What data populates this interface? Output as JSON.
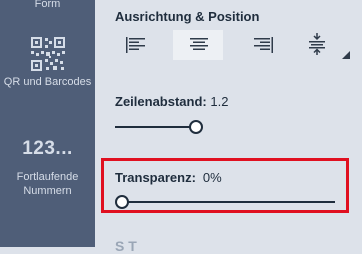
{
  "sidebar": {
    "items": [
      {
        "label": "Form"
      },
      {
        "label": "QR und Barcodes"
      },
      {
        "glyph": "123...",
        "label": "Fortlaufende Nummern"
      }
    ]
  },
  "panel": {
    "alignment": {
      "heading": "Ausrichtung & Position",
      "buttons": [
        {
          "icon": "align-left-icon"
        },
        {
          "icon": "align-center-icon",
          "active": true
        },
        {
          "icon": "align-right-icon"
        },
        {
          "icon": "vertical-align-icon"
        }
      ]
    },
    "line_spacing": {
      "label": "Zeilenabstand:",
      "value": "1.2"
    },
    "transparency": {
      "label": "Transparenz:",
      "value": "0%"
    },
    "cut_off_heading": "S     T"
  },
  "colors": {
    "sidebar_bg": "#4f5e78",
    "panel_bg": "#dde2ea",
    "highlight": "#e01020"
  }
}
